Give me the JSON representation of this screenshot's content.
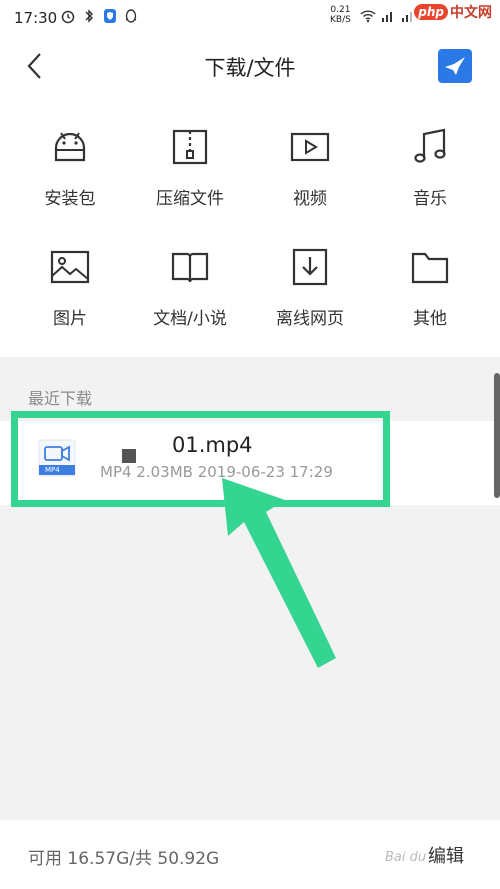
{
  "status_bar": {
    "time": "17:30",
    "net_speed_value": "0.21",
    "net_speed_unit": "KB/S",
    "watermark_php": "php",
    "watermark_text": "中文网"
  },
  "header": {
    "title": "下载/文件",
    "back_icon": "chevron-left-icon",
    "brand_icon": "bird-logo-icon"
  },
  "categories": [
    {
      "label": "安装包",
      "icon": "android-icon"
    },
    {
      "label": "压缩文件",
      "icon": "zip-icon"
    },
    {
      "label": "视频",
      "icon": "video-icon"
    },
    {
      "label": "音乐",
      "icon": "music-icon"
    },
    {
      "label": "图片",
      "icon": "image-icon"
    },
    {
      "label": "文档/小说",
      "icon": "book-icon"
    },
    {
      "label": "离线网页",
      "icon": "download-page-icon"
    },
    {
      "label": "其他",
      "icon": "folder-icon"
    }
  ],
  "recent": {
    "title": "最近下载",
    "items": [
      {
        "name": "01.mp4",
        "meta": "MP4 2.03MB 2019-06-23 17:29",
        "icon_badge": "MP4"
      }
    ]
  },
  "bottom": {
    "storage": "可用 16.57G/共 50.92G",
    "edit": "编辑",
    "baidu_watermark": "Bai du"
  },
  "colors": {
    "accent_blue": "#2b79e6",
    "highlight_green": "#34d491",
    "list_bg": "#f2f2f2"
  }
}
